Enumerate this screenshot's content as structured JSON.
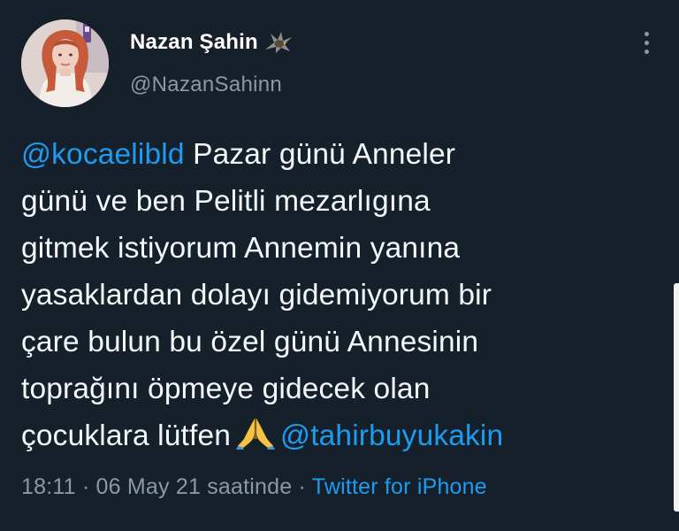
{
  "author": {
    "display_name": "Nazan Şahin",
    "handle": "@NazanSahinn",
    "badge_icon": "eagle-icon"
  },
  "tweet": {
    "lines": [
      {
        "mention": "@kocaelibld",
        "text": " Pazar günü Anneler"
      },
      {
        "text": "günü ve ben Pelitli mezarlıgına"
      },
      {
        "text": "gitmek istiyorum Annemin yanına"
      },
      {
        "text": "yasaklardan dolayı gidemiyorum bir"
      },
      {
        "text": "çare bulun bu özel günü Annesinin"
      },
      {
        "text": "toprağını öpmeye gidecek olan"
      },
      {
        "text": "çocuklara lütfen",
        "emoji": "folded-hands-emoji",
        "mention": "@tahirbuyukakin"
      }
    ]
  },
  "meta": {
    "time": "18:11",
    "separator": " · ",
    "date": "06 May 21 saatinde",
    "source": "Twitter for iPhone"
  },
  "colors": {
    "background": "#15202b",
    "link": "#1d9bf0",
    "secondary": "#8b98a5",
    "text": "#f5f8fa"
  }
}
